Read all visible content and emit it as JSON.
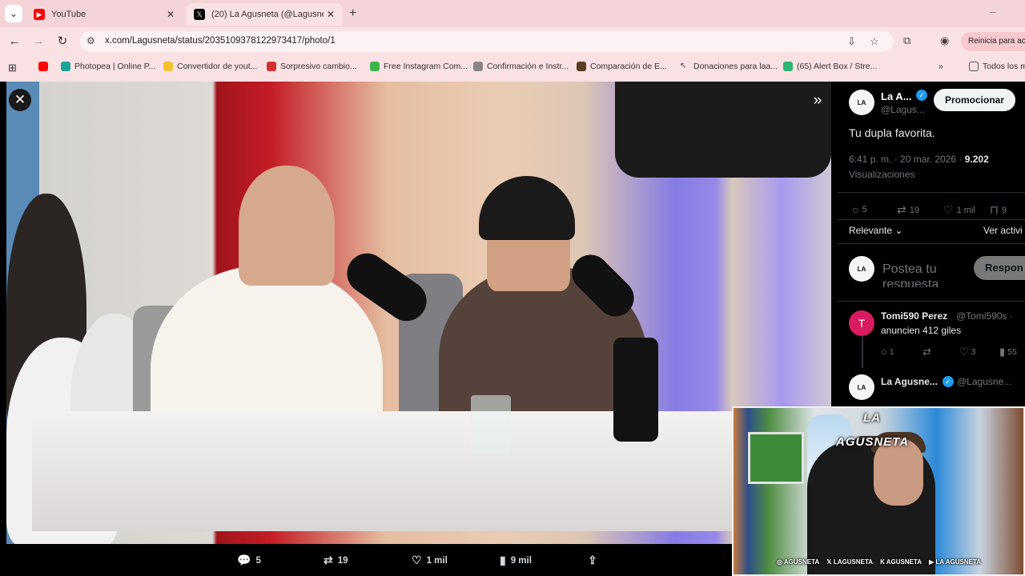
{
  "browser": {
    "tabs": [
      {
        "title": "YouTube",
        "icon": "youtube-icon",
        "active": false
      },
      {
        "title": "(20) La Agusneta (@Lagusneta)",
        "icon": "x-logo-icon",
        "active": true
      }
    ],
    "url": "x.com/Lagusneta/status/2035109378122973417/photo/1",
    "restart_label": "Reinicia para act",
    "bookmarks": [
      "Photopea | Online P...",
      "Convertidor de yout...",
      "Sorpresivo cambio...",
      "Free Instagram Com...",
      "Confirmación e Instr...",
      "Comparación de E...",
      "Donaciones para laa...",
      "(65) Alert Box / Stre...",
      "Todos los m"
    ]
  },
  "photo_actions": {
    "replies": "5",
    "reposts": "19",
    "likes": "1 mil",
    "views": "9 mil"
  },
  "tweet": {
    "author": "La A...",
    "handle": "@Lagus...",
    "promote_label": "Promocionar",
    "text": "Tu dupla favorita.",
    "time": "6:41 p. m. · 20 mar. 2026 · ",
    "view_count": "9.202",
    "views_label": "Visualizaciones",
    "stats": {
      "replies": "5",
      "reposts": "19",
      "likes": "1 mil",
      "bookmarks": "9"
    },
    "sort_label": "Relevante",
    "see_activity": "Ver activi",
    "reply_placeholder": "Postea tu respuesta",
    "reply_button": "Respon"
  },
  "replies": [
    {
      "avatar_letter": "T",
      "name": "Tomi590 Perez",
      "handle": "@Tomi590s · ",
      "text": "anuncien 412 giles",
      "stats": {
        "replies": "1",
        "likes": "3",
        "views": "55"
      }
    },
    {
      "name": "La Agusne...",
      "handle": "@Lagusne..."
    }
  ],
  "webcam": {
    "logo_text": "LA AGUSNETA",
    "social": [
      "AGUSNETA",
      "LAGUSNETA",
      "AGUSNETA",
      "LA AGUSNETA"
    ]
  },
  "colors": {
    "accent": "#1d9bf0",
    "tabstrip": "#f4d4d9",
    "panel_bg": "#000000"
  }
}
